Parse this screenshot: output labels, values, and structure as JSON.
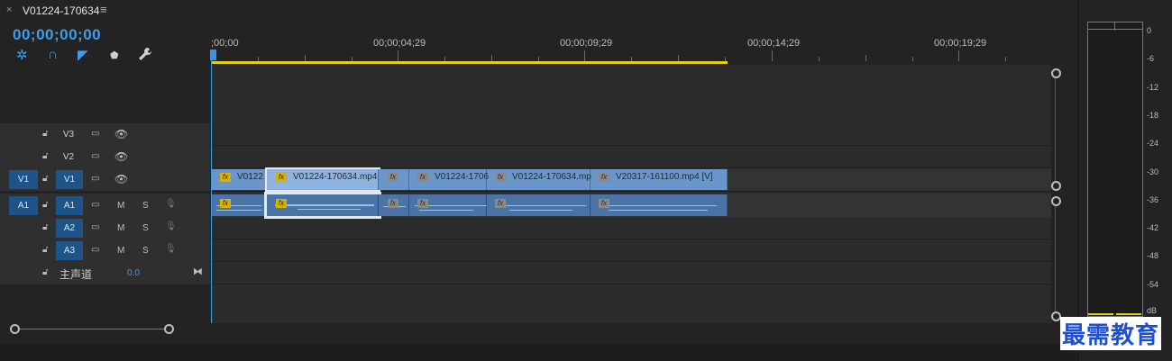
{
  "tab": {
    "close_glyph": "×",
    "title": "V01224-170634",
    "menu_glyph": "≡"
  },
  "timecode": "00;00;00;00",
  "tools": [
    {
      "name": "snap-icon",
      "glyph": "✲"
    },
    {
      "name": "linked-selection-icon",
      "glyph": "∩"
    },
    {
      "name": "add-marker-icon",
      "glyph": "◤"
    },
    {
      "name": "marker-icon",
      "glyph": "⬟"
    },
    {
      "name": "wrench-icon",
      "glyph": "🔧"
    }
  ],
  "ruler": {
    "labels": [
      ";00;00",
      "00;00;04;29",
      "00;00;09;29",
      "00;00;14;29",
      "00;00;19;29"
    ]
  },
  "video_tracks": [
    {
      "source": "",
      "name": "V3"
    },
    {
      "source": "",
      "name": "V2"
    },
    {
      "source": "V1",
      "name": "V1"
    }
  ],
  "audio_tracks": [
    {
      "source": "A1",
      "name": "A1",
      "m": "M",
      "s": "S"
    },
    {
      "source": "",
      "name": "A2",
      "m": "M",
      "s": "S"
    },
    {
      "source": "",
      "name": "A3",
      "m": "M",
      "s": "S"
    }
  ],
  "master": {
    "label": "主声道",
    "value": "0.0"
  },
  "video_clips": [
    {
      "name": "V0122",
      "fx": "yellow"
    },
    {
      "name": "V01224-170634.mp4",
      "fx": "yellow"
    },
    {
      "name": "",
      "fx": "gray"
    },
    {
      "name": "V01224-1706",
      "fx": "gray"
    },
    {
      "name": "V01224-170634.mp",
      "fx": "gray"
    },
    {
      "name": "V20317-161100.mp4 [V]",
      "fx": "gray"
    }
  ],
  "meter": {
    "scale": [
      "0",
      "-6",
      "-12",
      "-18",
      "-24",
      "-30",
      "-36",
      "-42",
      "-48",
      "-54",
      "dB"
    ]
  },
  "watermark": "最需教育",
  "colors": {
    "accent": "#3f9ee8",
    "work_area": "#e5d400",
    "video_clip": "#6b96c9",
    "audio_clip": "#4a73a6"
  }
}
